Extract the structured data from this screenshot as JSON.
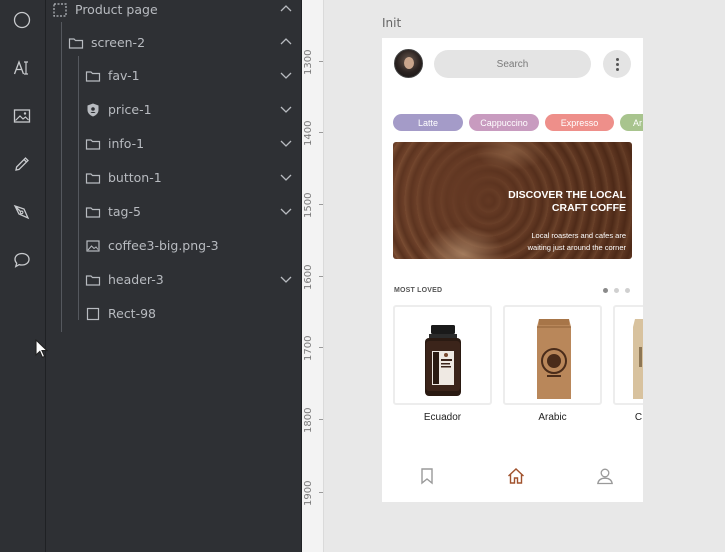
{
  "toolbar": {
    "tools": [
      {
        "icon": "ellipse-icon"
      },
      {
        "icon": "text-ai-icon"
      },
      {
        "icon": "image-icon"
      },
      {
        "icon": "pencil-icon"
      },
      {
        "icon": "pen-tool-icon"
      },
      {
        "icon": "comment-icon"
      }
    ]
  },
  "layers": {
    "items": [
      {
        "label": "Product page",
        "icon": "frame-icon",
        "expanded": true
      },
      {
        "label": "screen-2",
        "icon": "folder-icon",
        "expanded": true
      },
      {
        "label": "fav-1",
        "icon": "folder-icon",
        "expanded": false
      },
      {
        "label": "price-1",
        "icon": "shield-icon",
        "expanded": false
      },
      {
        "label": "info-1",
        "icon": "folder-icon",
        "expanded": false
      },
      {
        "label": "button-1",
        "icon": "folder-icon",
        "expanded": false
      },
      {
        "label": "tag-5",
        "icon": "folder-icon",
        "expanded": false
      },
      {
        "label": "coffee3-big.png-3",
        "icon": "image-icon"
      },
      {
        "label": "header-3",
        "icon": "folder-icon",
        "expanded": false
      },
      {
        "label": "Rect-98",
        "icon": "rectangle-icon"
      }
    ]
  },
  "ruler": {
    "labels": [
      "1300",
      "1400",
      "1500",
      "1600",
      "1700",
      "1800",
      "1900"
    ]
  },
  "artboard": {
    "title": "Init",
    "search_placeholder": "Search",
    "chips": [
      {
        "label": "Latte",
        "color": "#a49bc8"
      },
      {
        "label": "Cappuccino",
        "color": "#c89bbf"
      },
      {
        "label": "Expresso",
        "color": "#ee8f8a"
      },
      {
        "label": "Ar",
        "color": "#a8c48e"
      }
    ],
    "banner": {
      "title_line1": "DISCOVER THE LOCAL",
      "title_line2": "CRAFT COFFE",
      "subtitle_line1": "Local roasters and cafes are",
      "subtitle_line2": "waiting just around the corner"
    },
    "section_title": "MOST LOVED",
    "products": [
      {
        "name": "Ecuador"
      },
      {
        "name": "Arabic"
      },
      {
        "name": "C"
      }
    ],
    "nav": [
      {
        "icon": "bookmark-icon"
      },
      {
        "icon": "home-icon",
        "color": "#a0522d"
      },
      {
        "icon": "user-icon"
      }
    ]
  },
  "colors": {
    "panel_bg": "#2e3034",
    "accent": "#a0522d",
    "page_bg": "#e8e8e8"
  }
}
